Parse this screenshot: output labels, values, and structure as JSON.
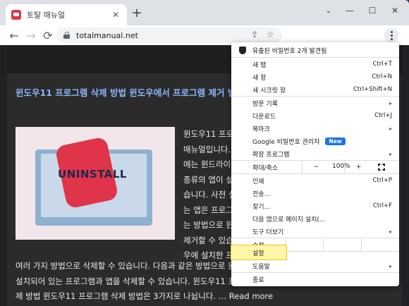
{
  "browser": {
    "tab_title": "토탈 매뉴얼",
    "tab_close": "✕",
    "new_tab": "+",
    "url": "totalmanual.net",
    "window_controls": {
      "dropdown": "⌄",
      "minimize": "—",
      "maximize": "☐",
      "close": "✕"
    },
    "nav": {
      "back": "←",
      "forward": "→",
      "reload": "⟳"
    },
    "share_icon": "⇪",
    "star_icon": "☆"
  },
  "article": {
    "headline": "윈도우11 프로그램 삭제 방법 윈도우에서 프로그램 제거 법",
    "image_text": "UNINSTALL",
    "side_lines": [
      "윈도우11 프로그",
      "매뉴얼입니다.",
      "에는 윈드라이",
      "종류의 앱이 설",
      "습니다. 사전 설",
      "는 앱은 프로그",
      "는 방법으로 윈",
      "제거할 수 있습",
      "우에 설치한 프"
    ],
    "full_lines": [
      "여러 가지 방법으로 삭제할 수 있습니다. 다음과 같은 방법으로 윈",
      "설치되어 있는 프로그램과 앱을 삭제할 수 있습니다. 윈도우11 프",
      "제 방법 윈도우11 프로그램 삭제 방법은 3가지로 나뉩니다. …"
    ],
    "read_more": "Read more"
  },
  "menu": {
    "breach_alert": "유출된 비밀번호 2개 발견됨",
    "new_tab": {
      "label": "새 탭",
      "shortcut": "Ctrl+T"
    },
    "new_window": {
      "label": "새 창",
      "shortcut": "Ctrl+N"
    },
    "incognito": {
      "label": "새 시크릿 창",
      "shortcut": "Ctrl+Shift+N"
    },
    "history": {
      "label": "방문 기록"
    },
    "downloads": {
      "label": "다운로드",
      "shortcut": "Ctrl+J"
    },
    "bookmarks": {
      "label": "북마크"
    },
    "password_manager": {
      "label": "Google 비밀번호 관리자",
      "badge": "New"
    },
    "extensions": {
      "label": "확장 프로그램"
    },
    "zoom": {
      "label": "확대/축소",
      "minus": "−",
      "value": "100%",
      "plus": "+"
    },
    "print": {
      "label": "인쇄",
      "shortcut": "Ctrl+P"
    },
    "cast": {
      "label": "전송..."
    },
    "find": {
      "label": "찾기...",
      "shortcut": "Ctrl+F"
    },
    "install": {
      "label": "다음 앱으로 페이지 설치(..."
    },
    "more_tools": {
      "label": "도구 더보기"
    },
    "edit": {
      "label": "수정"
    },
    "settings": {
      "label": "설정"
    },
    "help": {
      "label": "도움말"
    },
    "exit": {
      "label": "종료"
    },
    "submenu_arrow": "▸"
  },
  "colors": {
    "menu_highlight": "#fff7a8",
    "new_badge": "#1a73e8",
    "headline": "#8ab4f8"
  }
}
